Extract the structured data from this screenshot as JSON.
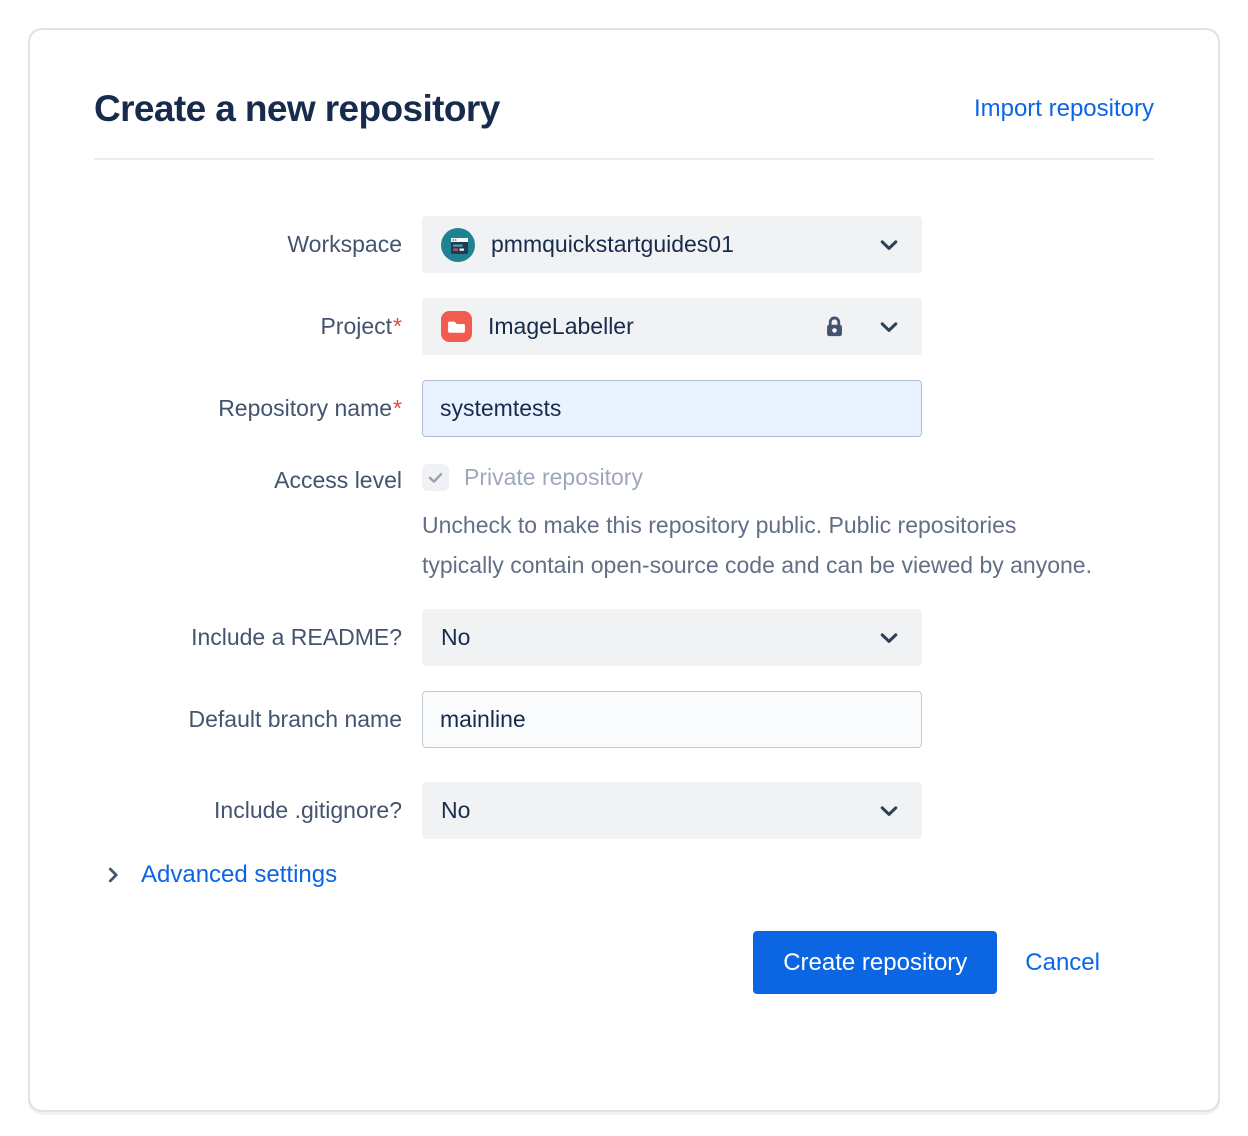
{
  "page": {
    "title": "Create a new repository",
    "import_link": "Import repository"
  },
  "form": {
    "workspace": {
      "label": "Workspace",
      "value": "pmmquickstartguides01"
    },
    "project": {
      "label": "Project",
      "required": "*",
      "value": "ImageLabeller"
    },
    "repo_name": {
      "label": "Repository name",
      "required": "*",
      "value": "systemtests"
    },
    "access_level": {
      "label": "Access level",
      "checkbox_label": "Private repository",
      "checkbox_state": "checked-disabled",
      "help_text": "Uncheck to make this repository public. Public repositories typically contain open-source code and can be viewed by anyone."
    },
    "readme": {
      "label": "Include a README?",
      "value": "No"
    },
    "default_branch": {
      "label": "Default branch name",
      "value": "mainline"
    },
    "gitignore": {
      "label": "Include .gitignore?",
      "value": "No"
    },
    "advanced_settings_label": "Advanced settings"
  },
  "footer": {
    "create_label": "Create repository",
    "cancel_label": "Cancel"
  },
  "icons": {
    "workspace_avatar": "workspace-avatar",
    "project": "folder-icon",
    "project_lock": "lock-icon",
    "dropdowns": "chevron-down-icon",
    "advanced_toggle": "chevron-right-icon",
    "checkbox": "checkmark-icon"
  },
  "colors": {
    "accent_blue": "#0C66E4",
    "title_text": "#172B4D",
    "label_text": "#44546F",
    "helper_text": "#626F86",
    "disabled_text": "#9FA8BA",
    "dropdown_bg": "#F1F2F4",
    "info_input_bg": "#E9F2FF",
    "card_border": "#DFE1E6",
    "project_icon_bg": "#F15B50",
    "workspace_avatar_bg": "#1E8292",
    "required_asterisk": "#E2483D"
  }
}
